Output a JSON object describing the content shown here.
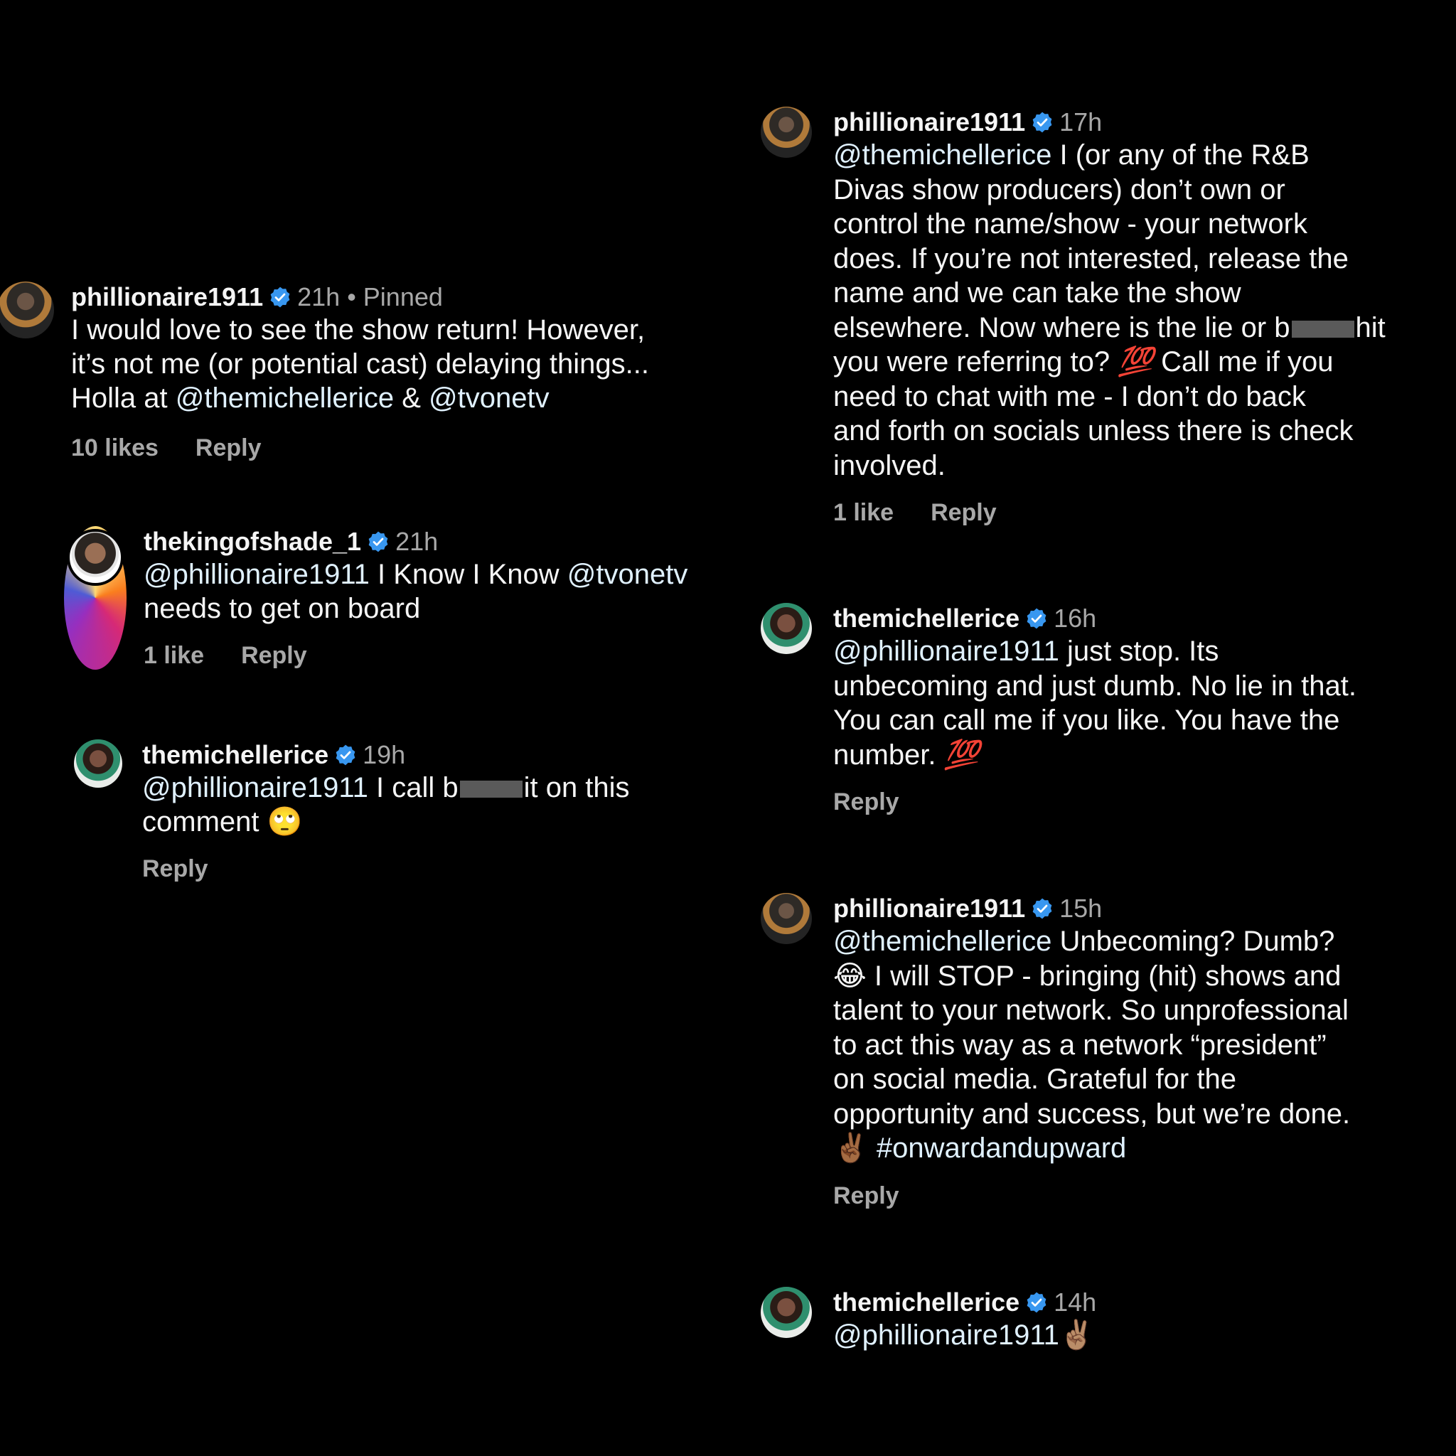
{
  "left": {
    "c1": {
      "username": "phillionaire1911",
      "meta": "21h • Pinned",
      "text": "I would love to see the show return! However,\nit’s not me (or potential cast) delaying things...\nHolla at ",
      "mention1": "@themichellerice",
      "mid": " & ",
      "mention2": "@tvonetv",
      "likes": "10 likes",
      "reply": "Reply"
    },
    "c2": {
      "username": "thekingofshade_1",
      "meta": "21h",
      "mention": "@phillionaire1911",
      "text_a": " I Know I Know ",
      "mention2": "@tvonetv",
      "text_b": "\nneeds to get on board",
      "likes": "1 like",
      "reply": "Reply"
    },
    "c3": {
      "username": "themichellerice",
      "meta": "19h",
      "mention": "@phillionaire1911",
      "text_a": " I call b",
      "text_b": "it on this\ncomment ",
      "emoji": "🙄",
      "reply": "Reply"
    }
  },
  "right": {
    "c4": {
      "username": "phillionaire1911",
      "meta": "17h",
      "mention": "@themichellerice",
      "text_a": " I (or any of the R&B\nDivas show producers) don’t own or\ncontrol the name/show - your network\ndoes. If you’re not interested, release the\nname and we can take the show\nelsewhere. Now where is the lie or b",
      "text_b": "hit\nyou were referring to? ",
      "emoji": "💯",
      "text_c": " Call me if you\nneed to chat with me - I don’t do back\nand forth on socials unless there is check\ninvolved.",
      "likes": "1 like",
      "reply": "Reply"
    },
    "c5": {
      "username": "themichellerice",
      "meta": "16h",
      "mention": "@phillionaire1911",
      "text": " just stop. Its\nunbecoming and just dumb. No lie in that.\nYou can call me if you like. You have the\nnumber. ",
      "emoji": "💯",
      "reply": "Reply"
    },
    "c6": {
      "username": "phillionaire1911",
      "meta": "15h",
      "mention": "@themichellerice",
      "text_a": " Unbecoming? Dumb?\n",
      "emoji1": "😂",
      "text_b": " I will STOP - bringing (hit) shows and\ntalent to your network. So unprofessional\nto act this way as a network “president”\non social media. Grateful for the\nopportunity and success, but we’re done.\n",
      "emoji2": "✌🏾",
      "hashtag": " #onwardandupward",
      "reply": "Reply"
    },
    "c7": {
      "username": "themichellerice",
      "meta": "14h",
      "mention": "@phillionaire1911",
      "emoji": " ✌🏽"
    }
  },
  "colors": {
    "background": "#000000",
    "text": "#f5f5f5",
    "muted": "#a8a8a8",
    "mention": "#e0f1ff",
    "verified": "#3897f0"
  },
  "icons": {
    "verified": "verified-badge-icon",
    "avatar": "profile-avatar"
  }
}
